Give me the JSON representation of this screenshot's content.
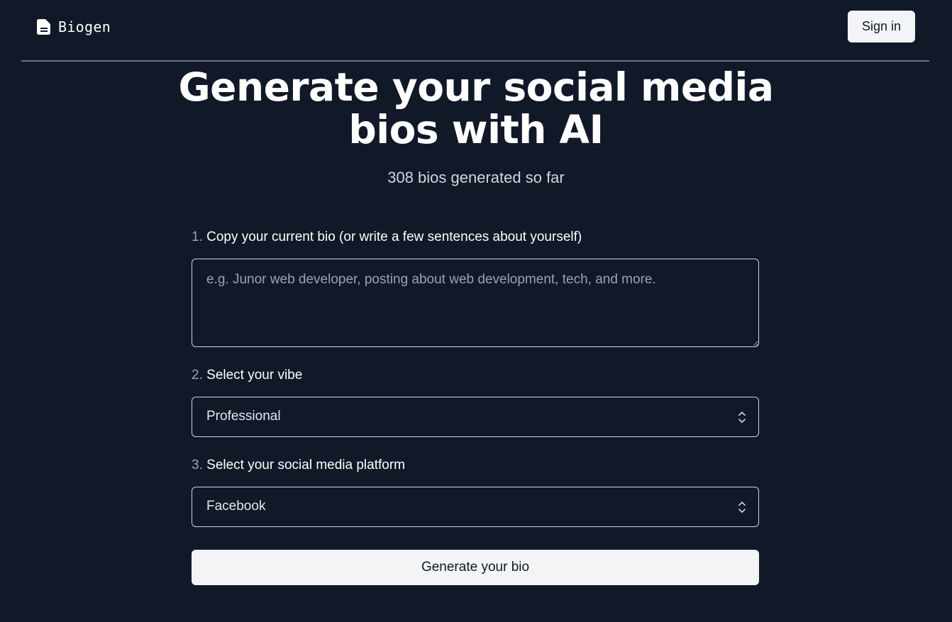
{
  "header": {
    "brand_name": "Biogen",
    "brand_icon": "document-icon",
    "signin_label": "Sign in"
  },
  "hero": {
    "title": "Generate your social media bios with AI",
    "counter": "308 bios generated so far"
  },
  "form": {
    "step1": {
      "number": "1.",
      "label": "Copy your current bio (or write a few sentences about yourself)",
      "placeholder": "e.g. Junor web developer, posting about web development, tech, and more.",
      "value": ""
    },
    "step2": {
      "number": "2.",
      "label": "Select your vibe",
      "selected": "Professional"
    },
    "step3": {
      "number": "3.",
      "label": "Select your social media platform",
      "selected": "Facebook"
    },
    "generate_label": "Generate your bio"
  },
  "colors": {
    "background": "#111827",
    "button_bg": "#f3f4f6",
    "border": "#d1d5db",
    "muted_text": "#9ca3af"
  }
}
